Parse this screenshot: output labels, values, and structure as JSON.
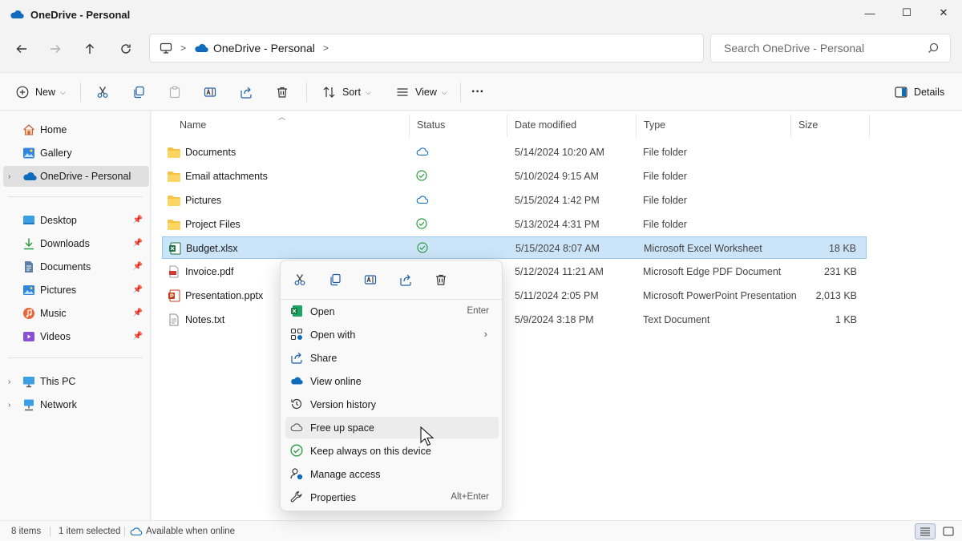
{
  "window": {
    "title": "OneDrive - Personal",
    "controls": {
      "minimize": "—",
      "maximize": "☐",
      "close": "✕"
    }
  },
  "address": {
    "crumb": "OneDrive - Personal",
    "separator": ">",
    "trailing_separator": ">"
  },
  "search": {
    "placeholder": "Search OneDrive - Personal"
  },
  "toolbar": {
    "new_label": "New",
    "sort_label": "Sort",
    "view_label": "View",
    "more_label": "···",
    "details_label": "Details"
  },
  "sidebar": {
    "quick": [
      {
        "label": "Home",
        "icon": "home-icon"
      },
      {
        "label": "Gallery",
        "icon": "gallery-icon"
      },
      {
        "label": "OneDrive - Personal",
        "icon": "onedrive-icon",
        "selected": true
      }
    ],
    "pinned": [
      {
        "label": "Desktop",
        "icon": "desktop-icon"
      },
      {
        "label": "Downloads",
        "icon": "downloads-icon"
      },
      {
        "label": "Documents",
        "icon": "documents-icon"
      },
      {
        "label": "Pictures",
        "icon": "pictures-icon"
      },
      {
        "label": "Music",
        "icon": "music-icon"
      },
      {
        "label": "Videos",
        "icon": "videos-icon"
      }
    ],
    "devices": [
      {
        "label": "This PC",
        "icon": "this-pc-icon"
      },
      {
        "label": "Network",
        "icon": "network-icon"
      }
    ]
  },
  "columns": {
    "name": "Name",
    "status": "Status",
    "date": "Date modified",
    "type": "Type",
    "size": "Size"
  },
  "files": [
    {
      "name": "Documents",
      "status": "cloud",
      "date": "5/14/2024 10:20 AM",
      "type": "File folder",
      "size": "",
      "kind": "folder"
    },
    {
      "name": "Email attachments",
      "status": "synced",
      "date": "5/10/2024 9:15 AM",
      "type": "File folder",
      "size": "",
      "kind": "folder"
    },
    {
      "name": "Pictures",
      "status": "cloud",
      "date": "5/15/2024 1:42 PM",
      "type": "File folder",
      "size": "",
      "kind": "folder"
    },
    {
      "name": "Project Files",
      "status": "synced",
      "date": "5/13/2024 4:31 PM",
      "type": "File folder",
      "size": "",
      "kind": "folder"
    },
    {
      "name": "Budget.xlsx",
      "status": "synced",
      "date": "5/15/2024 8:07 AM",
      "type": "Microsoft Excel Worksheet",
      "size": "18 KB",
      "kind": "excel",
      "selected": true
    },
    {
      "name": "Invoice.pdf",
      "status": "",
      "date": "5/12/2024 11:21 AM",
      "type": "Microsoft Edge PDF Document",
      "size": "231 KB",
      "kind": "pdf"
    },
    {
      "name": "Presentation.pptx",
      "status": "",
      "date": "5/11/2024 2:05 PM",
      "type": "Microsoft PowerPoint Presentation",
      "size": "2,013 KB",
      "kind": "pptx"
    },
    {
      "name": "Notes.txt",
      "status": "",
      "date": "5/9/2024 3:18 PM",
      "type": "Text Document",
      "size": "1 KB",
      "kind": "txt"
    }
  ],
  "context_menu": {
    "quick_actions": [
      "cut-icon",
      "copy-icon",
      "rename-icon",
      "share-icon",
      "delete-icon"
    ],
    "items": [
      {
        "label": "Open",
        "shortcut": "Enter",
        "icon": "excel-icon"
      },
      {
        "label": "Open with",
        "shortcut": "",
        "icon": "open-with-icon",
        "submenu": "›"
      },
      {
        "label": "Share",
        "shortcut": "",
        "icon": "share-icon"
      },
      {
        "label": "View online",
        "shortcut": "",
        "icon": "onedrive-icon"
      },
      {
        "label": "Version history",
        "shortcut": "",
        "icon": "history-icon"
      },
      {
        "label": "Free up space",
        "shortcut": "",
        "icon": "cloud-outline-icon",
        "hover": true
      },
      {
        "label": "Keep always on this device",
        "shortcut": "",
        "icon": "check-circle-icon"
      },
      {
        "label": "Manage access",
        "shortcut": "",
        "icon": "manage-access-icon"
      },
      {
        "label": "Properties",
        "shortcut": "Alt+Enter",
        "icon": "wrench-icon"
      }
    ]
  },
  "statusbar": {
    "count": "8 items",
    "selected": "1 item selected",
    "availability": "Available when online"
  },
  "colors": {
    "accent": "#0078d4",
    "onedrive": "#0f6cbd",
    "synced": "#2a9d3f",
    "folder": "#f5c242",
    "selection": "#cce4f7"
  }
}
